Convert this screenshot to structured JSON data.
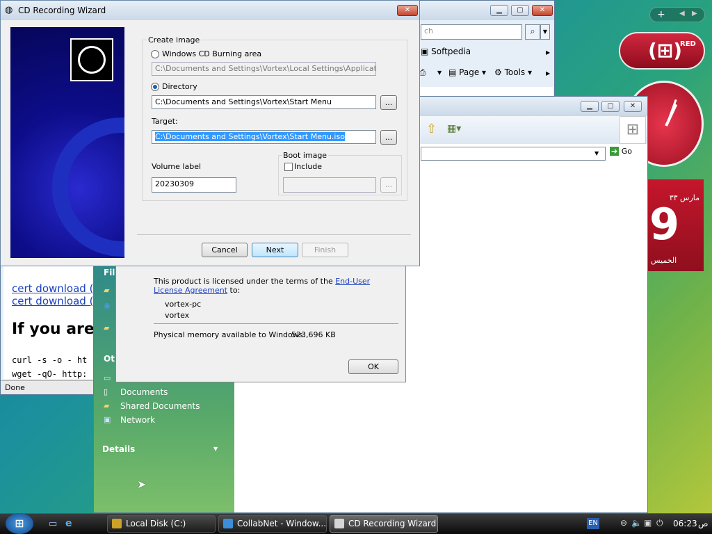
{
  "wizard": {
    "title": "CD Recording Wizard",
    "create_image_label": "Create image",
    "option_cd_burning": "Windows CD Burning area",
    "cd_burning_path": "C:\\Documents and Settings\\Vortex\\Local Settings\\Application Data",
    "option_directory": "Directory",
    "directory_path": "C:\\Documents and Settings\\Vortex\\Start Menu",
    "target_label": "Target:",
    "target_path": "C:\\Documents and Settings\\Vortex\\Start Menu.iso",
    "volume_label": "Volume label",
    "volume_value": "20230309",
    "boot_image_label": "Boot image",
    "include_label": "Include",
    "browse": "...",
    "cancel": "Cancel",
    "next": "Next",
    "finish": "Finish"
  },
  "about": {
    "license_text_1": "This product is licensed under the terms of the ",
    "license_link_1": "End-User",
    "license_link_2": "License Agreement",
    "license_text_2": " to:",
    "user1": "vortex-pc",
    "user2": "vortex",
    "memory_label": "Physical memory available to Windows:",
    "memory_value": "523,696 KB",
    "ok": "OK"
  },
  "browser": {
    "search_placeholder": "ch",
    "favorite": "Softpedia",
    "page_menu": "Page",
    "tools_menu": "Tools",
    "link1": "cert download (D",
    "link2": "cert download (P",
    "heading": "If you are",
    "code1": "curl -s -o - ht",
    "code2": "wget -qO- http:",
    "status": "Done"
  },
  "explorer": {
    "go": "Go",
    "file_menu": "File",
    "other_label": "Oth",
    "places": [
      "Documents",
      "Shared Documents",
      "Network"
    ],
    "details": "Details"
  },
  "gadgets": {
    "red_text": "RED",
    "calendar_month": "مارس ٣٣",
    "calendar_day": "9",
    "calendar_weekday": "الخميس"
  },
  "taskbar": {
    "items": [
      "Local Disk (C:)",
      "CollabNet - Window...",
      "CD Recording Wizard"
    ],
    "lang": "EN",
    "time": "06:23",
    "ampm": "ص"
  },
  "colors": {
    "accent_red": "#b3162b",
    "link_blue": "#1a3fc0",
    "selection": "#3399ff"
  }
}
